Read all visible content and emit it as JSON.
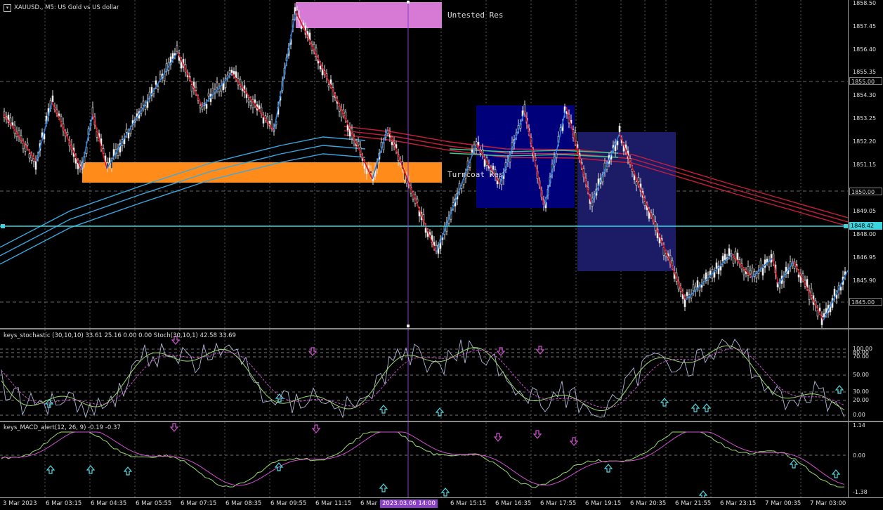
{
  "chart_title": "XAUUSD., M5:  US Gold vs US dollar",
  "zones": {
    "untested": "Untested Res",
    "turncoat": "Turncoat Res"
  },
  "price_axis": {
    "labels": [
      "1858.50",
      "1857.45",
      "1856.40",
      "1855.35",
      "1854.30",
      "1853.25",
      "1852.20",
      "1851.15",
      "1849.05",
      "1848.00",
      "1846.95",
      "1845.90"
    ],
    "boxes": {
      "level_1855": "1855.00",
      "level_1850": "1850.00",
      "current": "1848.42",
      "level_1845": "1845.00"
    }
  },
  "stoch": {
    "title": "keys_stochastic (30,10,10) 33.61 25.16 0.00 0.00 Stoch(30,10,1) 42.58 33.69",
    "levels": [
      "100.00",
      "80.00",
      "70.00",
      "50.00",
      "30.00",
      "20.00",
      "0.00"
    ]
  },
  "macd": {
    "title": "keys_MACD_alert(12, 26, 9) -0.19 -0.37",
    "levels": [
      "1.14",
      "0.00",
      "-1.38"
    ]
  },
  "time_axis": {
    "labels": [
      "3 Mar 2023",
      "6 Mar 03:15",
      "6 Mar 04:35",
      "6 Mar 05:55",
      "6 Mar 07:15",
      "6 Mar 08:35",
      "6 Mar 09:55",
      "6 Mar 11:15",
      "6 Mar 12:35",
      "6 Mar 15:15",
      "6 Mar 16:35",
      "6 Mar 17:55",
      "6 Mar 19:15",
      "6 Mar 20:35",
      "6 Mar 21:55",
      "6 Mar 23:15",
      "7 Mar 00:35",
      "7 Mar 03:00"
    ],
    "crosshair": "2023.03.06 14:00"
  },
  "colors": {
    "bull_zigzag": "#2a7fe0",
    "bear_zigzag": "#e01020",
    "supply_zone": "#d67ad6",
    "turncoat_zone": "#ff8c1a",
    "box_blue": "#00007a",
    "box_blue2": "#1c1c66",
    "ma_cyan": "#3aa8e0",
    "ma_red": "#c81e3c",
    "current_line": "#3ad6e0",
    "crosshair": "#8a3fc7"
  }
}
